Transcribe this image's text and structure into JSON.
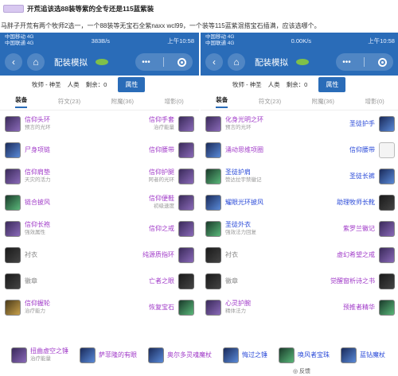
{
  "header": {
    "title": "开荒追该选88装等紫的全专还是115蓝紫装",
    "subtitle": "马胖子开荒有两个牧师2选一，一个88装等无宝石全紫naxx wcl99，一个装等115蓝紫混搭宝石插满，应该选哪个。"
  },
  "left_phone": {
    "status": {
      "carrier1": "中国移动 4G",
      "carrier2": "中国联通 4G",
      "speed": "383B/s",
      "time": "上午10:58"
    },
    "nav": {
      "back_icon": "‹",
      "home_icon": "⌂",
      "title": "配装模拟",
      "more_icon": "•••"
    },
    "filters": {
      "class": "牧师 - 神圣",
      "race": "人类",
      "remaining_label": "剩余：0",
      "attr_button": "属性"
    },
    "tabs": [
      "装备",
      "符文(23)",
      "附魔(36)",
      "增影(0)"
    ],
    "rows": [
      {
        "left": {
          "name": "信仰头环",
          "sub": "预言的光环",
          "color": "purple",
          "icon": "purple"
        },
        "right": {
          "name": "信仰手套",
          "sub": "治疗能量",
          "color": "purple",
          "icon": "purple"
        }
      },
      {
        "left": {
          "name": "尸身项链",
          "sub": "",
          "color": "purple",
          "icon": "blue"
        },
        "right": {
          "name": "信仰腰带",
          "sub": "",
          "color": "purple",
          "icon": "purple"
        }
      },
      {
        "left": {
          "name": "信仰肩垫",
          "sub": "天灾的活力",
          "color": "purple",
          "icon": "purple"
        },
        "right": {
          "name": "信仰护腿",
          "sub": "阿者的光环",
          "color": "purple",
          "icon": "purple"
        }
      },
      {
        "left": {
          "name": "链合披风",
          "sub": "",
          "color": "purple",
          "icon": "green"
        },
        "right": {
          "name": "信仰便鞋",
          "sub": "初级速度",
          "color": "purple",
          "icon": "purple"
        }
      },
      {
        "left": {
          "name": "信仰长袍",
          "sub": "强效属性",
          "color": "purple",
          "icon": "purple"
        },
        "right": {
          "name": "信仰之戒",
          "sub": "",
          "color": "purple",
          "icon": "purple"
        }
      },
      {
        "left": {
          "name": "衬衣",
          "sub": "",
          "color": "grey",
          "icon": "dark"
        },
        "right": {
          "name": "纯源质指环",
          "sub": "",
          "color": "purple",
          "icon": "purple"
        }
      },
      {
        "left": {
          "name": "徽章",
          "sub": "",
          "color": "grey",
          "icon": "dark"
        },
        "right": {
          "name": "亡者之眼",
          "sub": "",
          "color": "purple",
          "icon": "dark"
        }
      },
      {
        "left": {
          "name": "信仰握轮",
          "sub": "治疗能力",
          "color": "purple",
          "icon": "gold"
        },
        "right": {
          "name": "恢复宝石",
          "sub": "",
          "color": "purple",
          "icon": "green"
        }
      }
    ]
  },
  "right_phone": {
    "status": {
      "carrier1": "中国移动 4G",
      "carrier2": "中国联通 4G",
      "speed": "0.00K/s",
      "time": "上午10:58"
    },
    "nav": {
      "back_icon": "‹",
      "home_icon": "⌂",
      "title": "配装模拟",
      "more_icon": "•••"
    },
    "filters": {
      "class": "牧师 - 神圣",
      "race": "人类",
      "remaining_label": "剩余：0",
      "attr_button": "属性"
    },
    "tabs": [
      "装备",
      "符文(23)",
      "附魔(36)",
      "增影(0)"
    ],
    "rows": [
      {
        "left": {
          "name": "化身光明之环",
          "sub": "预言的光环",
          "color": "purple",
          "icon": "purple"
        },
        "right": {
          "name": "圣徒护手",
          "sub": "",
          "color": "blue",
          "icon": "blue"
        }
      },
      {
        "left": {
          "name": "涌动思维项圈",
          "sub": "",
          "color": "purple",
          "icon": "blue"
        },
        "right": {
          "name": "信仰腰带",
          "sub": "",
          "color": "blue",
          "icon": "empty"
        }
      },
      {
        "left": {
          "name": "圣徒护肩",
          "sub": "赞达拉宇禁徽记",
          "color": "blue",
          "icon": "green"
        },
        "right": {
          "name": "圣徒长裤",
          "sub": "",
          "color": "blue",
          "icon": "blue"
        }
      },
      {
        "left": {
          "name": "耀眼光环披风",
          "sub": "",
          "color": "blue",
          "icon": "blue"
        },
        "right": {
          "name": "助理牧师长靴",
          "sub": "",
          "color": "blue",
          "icon": "dark"
        }
      },
      {
        "left": {
          "name": "圣徒外衣",
          "sub": "强效法力回复",
          "color": "blue",
          "icon": "green"
        },
        "right": {
          "name": "紫罗兰徽记",
          "sub": "",
          "color": "purple",
          "icon": "purple"
        }
      },
      {
        "left": {
          "name": "衬衣",
          "sub": "",
          "color": "grey",
          "icon": "dark"
        },
        "right": {
          "name": "虚幻希望之戒",
          "sub": "",
          "color": "purple",
          "icon": "purple"
        }
      },
      {
        "left": {
          "name": "徽章",
          "sub": "",
          "color": "grey",
          "icon": "dark"
        },
        "right": {
          "name": "觉醒窗析诗之书",
          "sub": "",
          "color": "purple",
          "icon": "dark"
        }
      },
      {
        "left": {
          "name": "心灵护腕",
          "sub": "精体法力",
          "color": "purple",
          "icon": "purple"
        },
        "right": {
          "name": "预推者精华",
          "sub": "",
          "color": "purple",
          "icon": "green"
        }
      }
    ]
  },
  "bottom_items": [
    {
      "name": "扭曲虚空之锤",
      "sub": "治疗能量",
      "color": "purple",
      "icon": "purple"
    },
    {
      "name": "萨菲隆的有眼",
      "sub": "",
      "color": "purple",
      "icon": "blue"
    },
    {
      "name": "奥尔多灵魂魔杖",
      "sub": "",
      "color": "purple",
      "icon": "blue"
    },
    {
      "name": "悔过之锤",
      "sub": "",
      "color": "blue",
      "icon": "blue"
    },
    {
      "name": "唤风者宝珠",
      "sub": "",
      "color": "blue",
      "icon": "green"
    },
    {
      "name": "蓝钻魔杖",
      "sub": "",
      "color": "blue",
      "icon": "blue"
    }
  ],
  "feedback": "◎ 反馈"
}
